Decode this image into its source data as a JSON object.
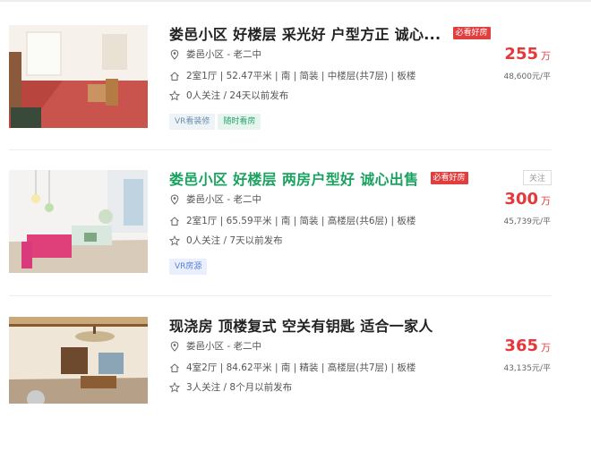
{
  "listings": [
    {
      "title": "娄邑小区 好楼层 采光好 户型方正 诚心...",
      "badge": "必看好房",
      "community": "娄邑小区 - 老二中",
      "details": "2室1厅 | 52.47平米 | 南 | 简装 | 中楼层(共7层) | 板楼",
      "follow_info": "0人关注 / 24天以前发布",
      "tags": [
        "VR看装修",
        "随时看房"
      ],
      "price": "255",
      "price_unit": "万",
      "unit_price": "48,600元/平"
    },
    {
      "title": "娄邑小区 好楼层 两房户型好 诚心出售",
      "badge": "必看好房",
      "follow_button": "关注",
      "community": "娄邑小区 - 老二中",
      "details": "2室1厅 | 65.59平米 | 南 | 简装 | 高楼层(共6层) | 板楼",
      "follow_info": "0人关注 / 7天以前发布",
      "tags": [
        "VR房源"
      ],
      "price": "300",
      "price_unit": "万",
      "unit_price": "45,739元/平"
    },
    {
      "title": "现浇房 顶楼复式 空关有钥匙 适合一家人",
      "community": "娄邑小区 - 老二中",
      "details": "4室2厅 | 84.62平米 | 南 | 精装 | 高楼层(共7层) | 板楼",
      "follow_info": "3人关注 / 8个月以前发布",
      "price": "365",
      "price_unit": "万",
      "unit_price": "43,135元/平"
    }
  ],
  "colors": {
    "price": "#e4393c",
    "title_highlight": "#1aa260",
    "badge": "#e13e3e"
  },
  "icons": [
    "location-pin-icon",
    "house-icon",
    "star-icon"
  ]
}
